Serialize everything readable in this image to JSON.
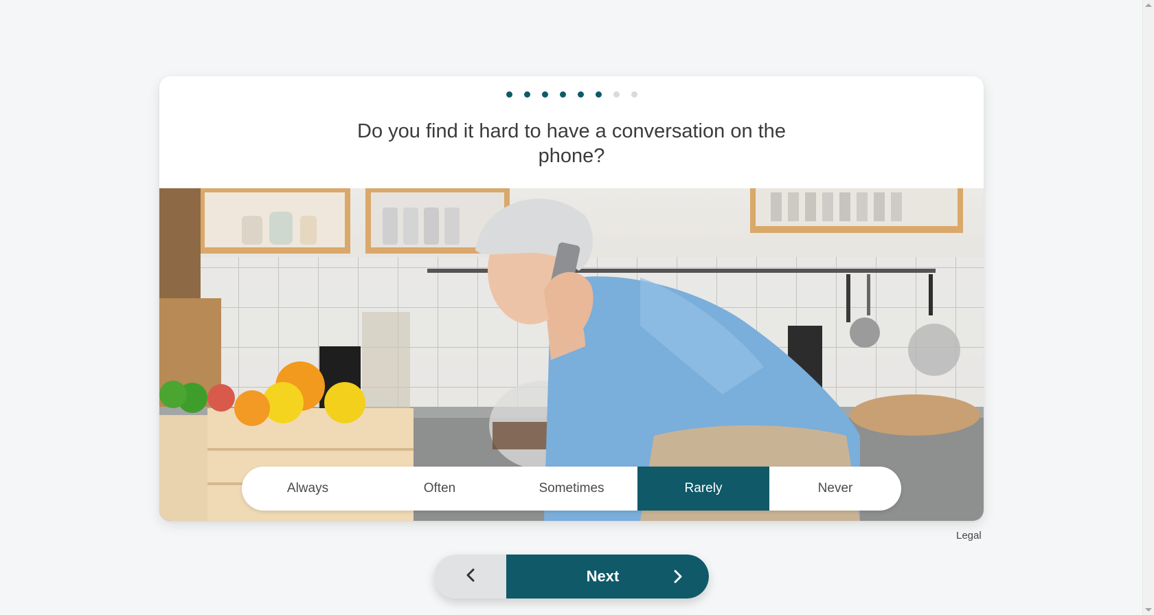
{
  "progress": {
    "total_steps": 8,
    "completed_steps": 6
  },
  "question": {
    "text": "Do you find it hard to have a conversation on the phone?"
  },
  "answers": {
    "options": [
      "Always",
      "Often",
      "Sometimes",
      "Rarely",
      "Never"
    ],
    "selected": "Rarely"
  },
  "footer": {
    "legal_label": "Legal"
  },
  "navigation": {
    "back_icon": "chevron-left-icon",
    "next_label": "Next",
    "next_icon": "chevron-right-icon"
  },
  "colors": {
    "primary": "#0f5968",
    "dot_inactive": "#d8dadb",
    "back_button": "#e1e2e3",
    "page_background": "#f5f6f7"
  }
}
